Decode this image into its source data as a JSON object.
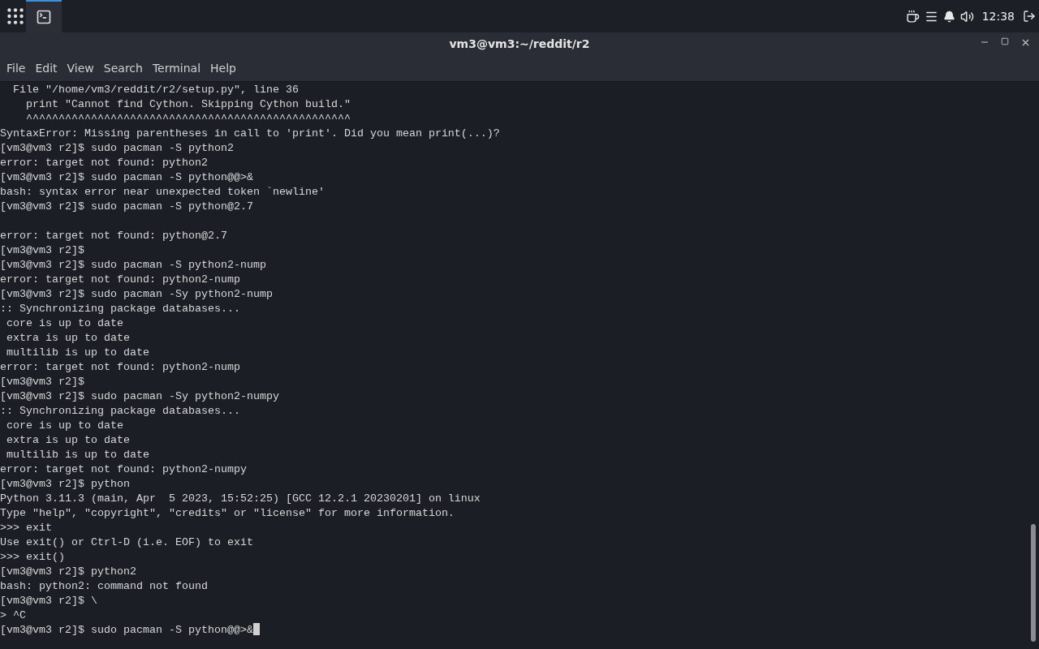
{
  "taskbar": {
    "apps": [
      {
        "selected": true
      }
    ],
    "clock": "12:38"
  },
  "window": {
    "title": "vm3@vm3:~/reddit/r2"
  },
  "menu": [
    "File",
    "Edit",
    "View",
    "Search",
    "Terminal",
    "Help"
  ],
  "terminal": {
    "lines": [
      {
        "text": "  File \"/home/vm3/reddit/r2/setup.py\", line 36"
      },
      {
        "text": "    print \"Cannot find Cython. Skipping Cython build.\""
      },
      {
        "text": "    ^^^^^^^^^^^^^^^^^^^^^^^^^^^^^^^^^^^^^^^^^^^^^^^^^^"
      },
      {
        "text": "SyntaxError: Missing parentheses in call to 'print'. Did you mean print(...)?"
      },
      {
        "text": "[vm3@vm3 r2]$ sudo pacman -S python2"
      },
      {
        "text": "error: target not found: python2"
      },
      {
        "text": "[vm3@vm3 r2]$ sudo pacman -S python@@>&"
      },
      {
        "text": "bash: syntax error near unexpected token `newline'"
      },
      {
        "text": "[vm3@vm3 r2]$ sudo pacman -S python@2.7"
      },
      {
        "text": "error: target not found: python@2.7",
        "blank_line_before": true
      },
      {
        "text": "[vm3@vm3 r2]$"
      },
      {
        "text": "[vm3@vm3 r2]$ sudo pacman -S python2-nump"
      },
      {
        "text": "error: target not found: python2-nump"
      },
      {
        "text": "[vm3@vm3 r2]$ sudo pacman -Sy python2-nump"
      },
      {
        "text": ":: Synchronizing package databases..."
      },
      {
        "text": " core is up to date"
      },
      {
        "text": " extra is up to date"
      },
      {
        "text": " multilib is up to date"
      },
      {
        "text": "error: target not found: python2-nump"
      },
      {
        "text": "[vm3@vm3 r2]$"
      },
      {
        "text": "[vm3@vm3 r2]$ sudo pacman -Sy python2-numpy"
      },
      {
        "text": ":: Synchronizing package databases..."
      },
      {
        "text": " core is up to date"
      },
      {
        "text": " extra is up to date"
      },
      {
        "text": " multilib is up to date"
      },
      {
        "text": "error: target not found: python2-numpy"
      },
      {
        "text": "[vm3@vm3 r2]$ python"
      },
      {
        "text": "Python 3.11.3 (main, Apr  5 2023, 15:52:25) [GCC 12.2.1 20230201] on linux"
      },
      {
        "text": "Type \"help\", \"copyright\", \"credits\" or \"license\" for more information."
      },
      {
        "text": ">>> exit"
      },
      {
        "text": "Use exit() or Ctrl-D (i.e. EOF) to exit"
      },
      {
        "text": ">>> exit()"
      },
      {
        "text": "[vm3@vm3 r2]$ python2"
      },
      {
        "text": "bash: python2: command not found"
      },
      {
        "text": "[vm3@vm3 r2]$ \\"
      },
      {
        "text": "> ^C"
      },
      {
        "text": "[vm3@vm3 r2]$ sudo pacman -S python@@>&",
        "cursor": true
      }
    ]
  }
}
